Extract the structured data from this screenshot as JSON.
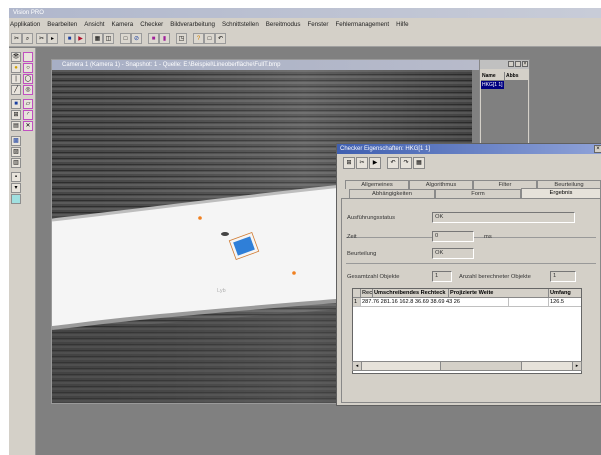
{
  "window": {
    "title": "Vision PRO"
  },
  "menu": [
    "Applikation",
    "Bearbeiten",
    "Ansicht",
    "Kamera",
    "Checker",
    "Bildverarbeitung",
    "Schnittstellen",
    "Bereitmodus",
    "Fenster",
    "Fehlermanagement",
    "Hilfe"
  ],
  "camera_window": {
    "title": "Camera 1 (Kamera 1) - Snapshot: 1 - Quelle: E:\\Beispiel\\Lineoberfläche\\FullT.bmp"
  },
  "side_panel": {
    "col_name": "Name",
    "col_abs": "Abbs",
    "selected": "HKG[1 1]"
  },
  "dialog": {
    "title": "Checker Eigenschaften: HKG[1 1]",
    "tabs_row1": [
      "Allgemeines",
      "Algorithmus",
      "Filter",
      "Beurteilung"
    ],
    "tabs_row2": [
      "Abhängigkeiten",
      "Form",
      "Ergebnis"
    ],
    "active_tab": "Ergebnis",
    "fields": {
      "status_label": "Ausführungsstatus",
      "status_value": "OK",
      "time_label": "Zeit",
      "time_value": "0",
      "time_unit": "ms",
      "rating_label": "Beurteilung",
      "rating_value": "OK",
      "total_label": "Gesamtzahl Objekte",
      "total_value": "1",
      "count_label": "Anzahl berechneter Objekte",
      "count_value": "1"
    },
    "grid": {
      "columns": [
        "Rechteck",
        "Umschreibendes Rechteck",
        "Projizierte Weite",
        "Umfang"
      ],
      "rows": [
        [
          "1",
          "287.76  281.16  162.8  36.69  38.69  43  26",
          "",
          "126.5"
        ]
      ]
    }
  },
  "image_label": "Lyb"
}
